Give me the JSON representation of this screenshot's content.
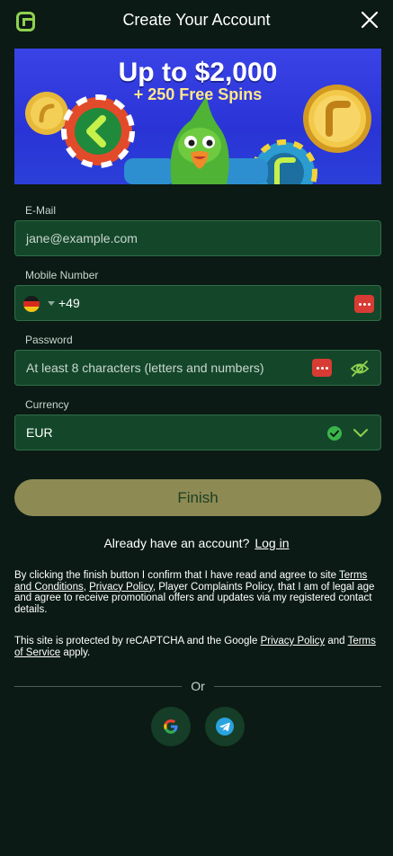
{
  "header": {
    "title": "Create Your Account"
  },
  "banner": {
    "line1": "Up to $2,000",
    "line2": "+ 250 Free Spins"
  },
  "form": {
    "email": {
      "label": "E-Mail",
      "placeholder": "jane@example.com"
    },
    "mobile": {
      "label": "Mobile Number",
      "country_flag": "germany-flag-icon",
      "dial_code": "+49"
    },
    "password": {
      "label": "Password",
      "placeholder": "At least 8 characters (letters and numbers)"
    },
    "currency": {
      "label": "Currency",
      "selected": "EUR"
    }
  },
  "actions": {
    "finish_label": "Finish",
    "have_account_text": "Already have an account?",
    "login_label": "Log in"
  },
  "legal": {
    "consent_prefix": "By clicking the finish button I confirm that I have read and agree to site",
    "terms_link": "Terms and Conditions",
    "comma": ",",
    "privacy_link": "Privacy Policy",
    "consent_suffix": ", Player Complaints Policy, that I am of legal age and agree to receive promotional offers and updates via my registered contact details.",
    "recaptcha_prefix": "This site is protected by reCAPTCHA and the Google",
    "recaptcha_privacy_link": "Privacy Policy",
    "recaptcha_and": "and",
    "recaptcha_terms_link": "Terms of Service",
    "recaptcha_suffix": "apply."
  },
  "divider": {
    "or_label": "Or"
  },
  "social": {
    "google_icon": "google-icon",
    "telegram_icon": "telegram-icon"
  },
  "colors": {
    "background": "#0b1a14",
    "field_bg": "#14472a",
    "accent_green": "#8fd14f",
    "finish_button": "#8d8a54",
    "badge_red": "#d83b33",
    "check_green": "#3ab54a"
  }
}
